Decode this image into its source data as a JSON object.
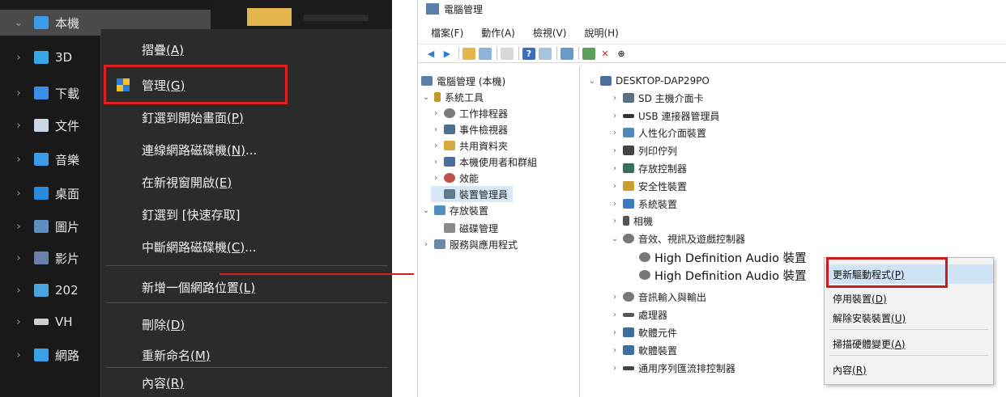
{
  "left": {
    "tree": [
      {
        "label": "本機",
        "icon": "pc-icon",
        "color": "#3d9be9"
      },
      {
        "label": "3D",
        "icon": "3d-objects-icon",
        "color": "#38a6e8"
      },
      {
        "label": "下載",
        "icon": "download-icon",
        "color": "#3a8ee6"
      },
      {
        "label": "文件",
        "icon": "document-icon",
        "color": "#c9d7e6"
      },
      {
        "label": "音樂",
        "icon": "music-icon",
        "color": "#3a9be8"
      },
      {
        "label": "桌面",
        "icon": "desktop-icon",
        "color": "#2b8ad9"
      },
      {
        "label": "圖片",
        "icon": "pictures-icon",
        "color": "#5d8fc2"
      },
      {
        "label": "影片",
        "icon": "videos-icon",
        "color": "#6b7fa8"
      },
      {
        "label": "202",
        "icon": "drive-icon",
        "color": "#4aa4e0"
      },
      {
        "label": "VH",
        "icon": "drive-icon",
        "color": "#cfcfcf"
      },
      {
        "label": "網路",
        "icon": "network-icon",
        "color": "#3aa0e8"
      }
    ],
    "context_menu": [
      {
        "text": "摺疊",
        "key": "(A)"
      },
      {
        "text": "管理",
        "key": "(G)"
      },
      {
        "text": "釘選到開始畫面",
        "key": "(P)"
      },
      {
        "text": "連線網路磁碟機",
        "key": "(N)",
        "suffix": "..."
      },
      {
        "text": "在新視窗開啟",
        "key": "(E)"
      },
      {
        "text": "釘選到 [快速存取]",
        "key": ""
      },
      {
        "text": "中斷網路磁碟機",
        "key": "(C)",
        "suffix": "..."
      },
      {
        "text": "新增一個網路位置",
        "key": "(L)"
      },
      {
        "text": "刪除",
        "key": "(D)"
      },
      {
        "text": "重新命名",
        "key": "(M)"
      },
      {
        "text": "內容",
        "key": "(R)"
      }
    ]
  },
  "window": {
    "title": "電腦管理",
    "menu": [
      "檔案(F)",
      "動作(A)",
      "檢視(V)",
      "說明(H)"
    ],
    "nav_tree": [
      {
        "label": "電腦管理 (本機)",
        "icon_color": "#5a7fa8"
      },
      {
        "label": "系統工具",
        "icon_color": "#c29a2a"
      },
      {
        "label": "工作排程器",
        "icon_color": "#7a7a7a"
      },
      {
        "label": "事件檢視器",
        "icon_color": "#4f6f8f"
      },
      {
        "label": "共用資料夾",
        "icon_color": "#d7a93b"
      },
      {
        "label": "本機使用者和群組",
        "icon_color": "#4a6f9a"
      },
      {
        "label": "效能",
        "icon_color": "#c44d4d"
      },
      {
        "label": "裝置管理員",
        "icon_color": "#607d8b"
      },
      {
        "label": "存放裝置",
        "icon_color": "#4f8fbf"
      },
      {
        "label": "磁碟管理",
        "icon_color": "#8a8a8a"
      },
      {
        "label": "服務與應用程式",
        "icon_color": "#6a8aaa"
      }
    ],
    "devices": [
      {
        "label": "DESKTOP-DAP29PO",
        "icon_color": "#4a6fa0"
      },
      {
        "label": "SD 主機介面卡",
        "icon_color": "#5a6f80"
      },
      {
        "label": "USB 連接器管理員",
        "icon_color": "#333333"
      },
      {
        "label": "人性化介面裝置",
        "icon_color": "#4f8abf"
      },
      {
        "label": "列印佇列",
        "icon_color": "#444444"
      },
      {
        "label": "存放控制器",
        "icon_color": "#3a6f5a"
      },
      {
        "label": "安全性裝置",
        "icon_color": "#c9a030"
      },
      {
        "label": "系統裝置",
        "icon_color": "#3a7ac0"
      },
      {
        "label": "相機",
        "icon_color": "#555555"
      },
      {
        "label": "音效、視訊及遊戲控制器",
        "icon_color": "#777777"
      },
      {
        "label": "High Definition Audio 裝置",
        "icon_color": "#777777"
      },
      {
        "label": "High Definition Audio 裝置",
        "icon_color": "#777777"
      },
      {
        "label": "音訊輸入與輸出",
        "icon_color": "#777777"
      },
      {
        "label": "處理器",
        "icon_color": "#555555"
      },
      {
        "label": "軟體元件",
        "icon_color": "#3a6fa0"
      },
      {
        "label": "軟體裝置",
        "icon_color": "#3a6fa0"
      },
      {
        "label": "通用序列匯流排控制器",
        "icon_color": "#444444"
      }
    ],
    "device_menu": [
      {
        "text": "更新驅動程式",
        "key": "(P)"
      },
      {
        "text": "停用裝置",
        "key": "(D)"
      },
      {
        "text": "解除安裝裝置",
        "key": "(U)"
      },
      {
        "text": "掃描硬體變更",
        "key": "(A)"
      },
      {
        "text": "內容",
        "key": "(R)"
      }
    ]
  },
  "colors": {
    "highlight_red": "#e02020",
    "selection_blue": "#cfe4f7"
  }
}
